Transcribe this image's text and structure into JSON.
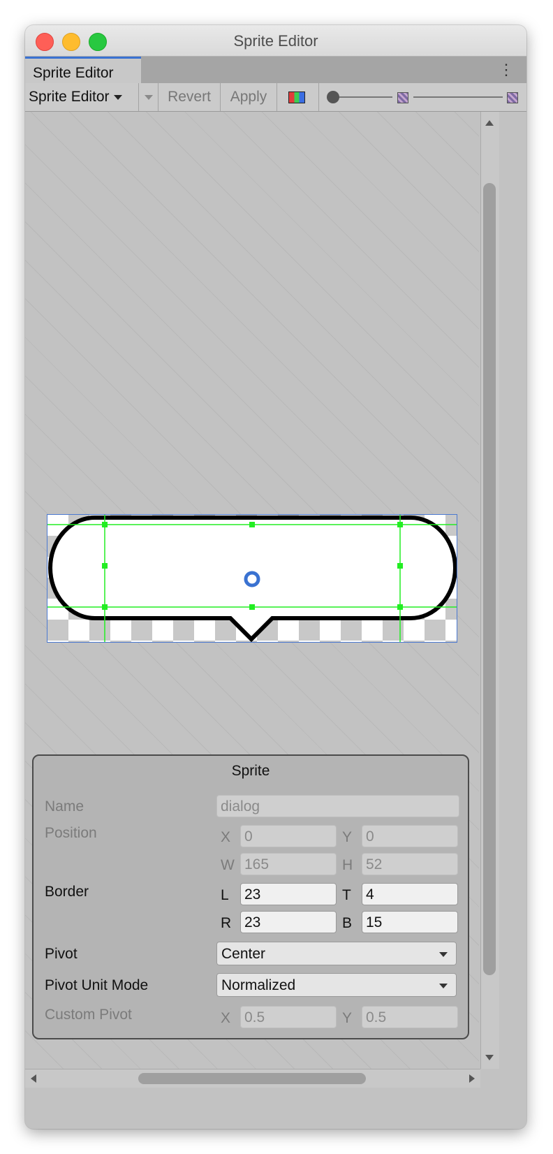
{
  "window": {
    "title": "Sprite Editor"
  },
  "tab": {
    "label": "Sprite Editor"
  },
  "toolbar": {
    "mode_label": "Sprite Editor",
    "revert_label": "Revert",
    "apply_label": "Apply"
  },
  "sprite_panel": {
    "title": "Sprite",
    "name_label": "Name",
    "name_value": "dialog",
    "position_label": "Position",
    "x_label": "X",
    "x_value": "0",
    "y_label": "Y",
    "y_value": "0",
    "w_label": "W",
    "w_value": "165",
    "h_label": "H",
    "h_value": "52",
    "border_label": "Border",
    "l_label": "L",
    "l_value": "23",
    "t_label": "T",
    "t_value": "4",
    "r_label": "R",
    "r_value": "23",
    "b_label": "B",
    "b_value": "15",
    "pivot_label": "Pivot",
    "pivot_value": "Center",
    "pivot_unit_label": "Pivot Unit Mode",
    "pivot_unit_value": "Normalized",
    "custom_pivot_label": "Custom Pivot",
    "cx_label": "X",
    "cx_value": "0.5",
    "cy_label": "Y",
    "cy_value": "0.5"
  },
  "colors": {
    "selection": "#4a78d0",
    "border_handles": "#22ee22",
    "pivot": "#3a72d1"
  }
}
